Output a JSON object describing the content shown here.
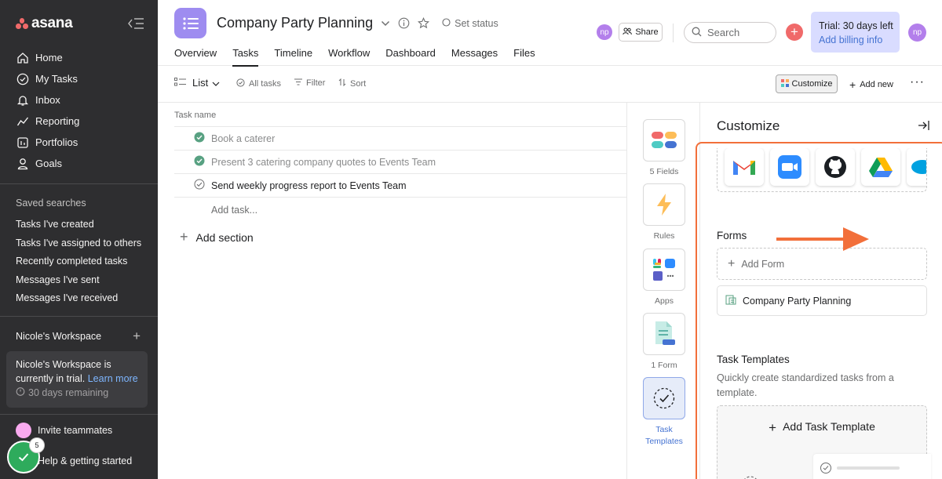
{
  "sidebar": {
    "logo": "asana",
    "nav": [
      {
        "label": "Home",
        "icon": "home-icon"
      },
      {
        "label": "My Tasks",
        "icon": "check-circle-icon"
      },
      {
        "label": "Inbox",
        "icon": "bell-icon"
      },
      {
        "label": "Reporting",
        "icon": "reporting-icon"
      },
      {
        "label": "Portfolios",
        "icon": "portfolio-icon"
      },
      {
        "label": "Goals",
        "icon": "goals-icon"
      }
    ],
    "saved_title": "Saved searches",
    "saved": [
      "Tasks I've created",
      "Tasks I've assigned to others",
      "Recently completed tasks",
      "Messages I've sent",
      "Messages I've received"
    ],
    "workspace": "Nicole's Workspace",
    "trial_text": "Nicole's Workspace is currently in trial.",
    "learn_more": "Learn more",
    "remaining": "30 days remaining",
    "invite": "Invite teammates",
    "help": "Help & getting started",
    "badge_count": "5"
  },
  "header": {
    "title": "Company Party Planning",
    "set_status": "Set status",
    "tabs": [
      "Overview",
      "Tasks",
      "Timeline",
      "Workflow",
      "Dashboard",
      "Messages",
      "Files"
    ],
    "active_tab": "Tasks",
    "avatar": "np",
    "share": "Share",
    "search_placeholder": "Search",
    "trial_line1": "Trial: 30 days left",
    "trial_line2": "Add billing info"
  },
  "toolbar": {
    "view": "List",
    "all_tasks": "All tasks",
    "filter": "Filter",
    "sort": "Sort",
    "customize": "Customize",
    "add_new": "Add new"
  },
  "tasks": {
    "column_header": "Task name",
    "rows": [
      {
        "name": "Book a caterer",
        "done": true
      },
      {
        "name": "Present 3 catering company quotes to Events Team",
        "done": true
      },
      {
        "name": "Send weekly progress report to Events Team",
        "done": false
      }
    ],
    "add_task": "Add task...",
    "add_section": "Add section"
  },
  "rail": [
    {
      "label": "5 Fields",
      "icon": "fields-icon"
    },
    {
      "label": "Rules",
      "icon": "lightning-icon"
    },
    {
      "label": "Apps",
      "icon": "apps-icon"
    },
    {
      "label": "1 Form",
      "icon": "form-icon"
    },
    {
      "label": "Task Templates",
      "icon": "task-template-icon"
    }
  ],
  "panel": {
    "title": "Customize",
    "apps": [
      "gmail-icon",
      "zoom-icon",
      "github-icon",
      "google-drive-icon",
      "salesforce-icon"
    ],
    "forms_title": "Forms",
    "add_form": "Add Form",
    "form_name": "Company Party Planning",
    "tt_title": "Task Templates",
    "tt_desc": "Quickly create standardized tasks from a template.",
    "add_tt": "Add Task Template"
  },
  "colors": {
    "sidebar_bg": "#2e2e30",
    "accent_red": "#f06a6a",
    "highlight_orange": "#f26f3a",
    "project_purple": "#9e8cf0",
    "trial_bg": "#d9dcff",
    "link_blue": "#4573d2",
    "done_green": "#58a182"
  }
}
